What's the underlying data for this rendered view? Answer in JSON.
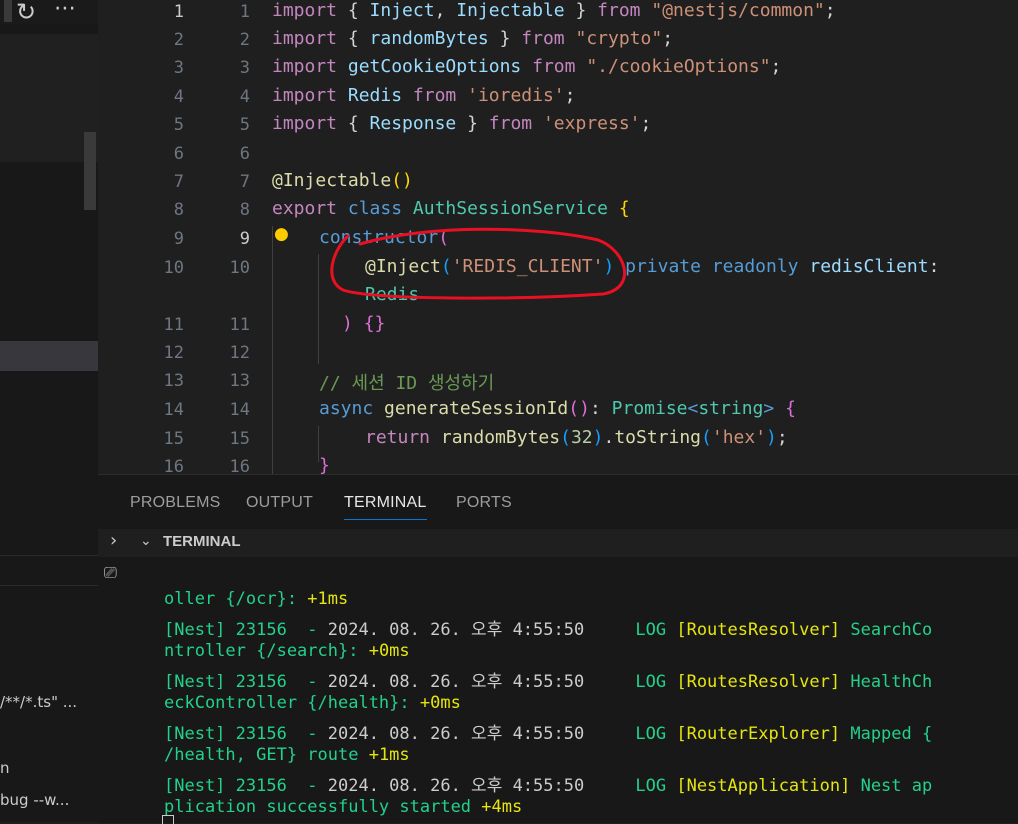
{
  "sidebar": {
    "toolbar_refresh_icon": "↻",
    "toolbar_more_icon": "⋯",
    "snippet_1": "/**/*.ts\" ...",
    "snippet_2": "n",
    "snippet_3": "bug --w..."
  },
  "editor": {
    "lines": [
      {
        "n1": "1",
        "n2": "1"
      },
      {
        "n1": "2",
        "n2": "2"
      },
      {
        "n1": "3",
        "n2": "3"
      },
      {
        "n1": "4",
        "n2": "4"
      },
      {
        "n1": "5",
        "n2": "5"
      },
      {
        "n1": "6",
        "n2": "6"
      },
      {
        "n1": "7",
        "n2": "7"
      },
      {
        "n1": "8",
        "n2": "8"
      },
      {
        "n1": "9",
        "n2": "9"
      },
      {
        "n1": "10",
        "n2": "10"
      },
      {
        "n1": "11",
        "n2": "11"
      },
      {
        "n1": "12",
        "n2": "12"
      },
      {
        "n1": "13",
        "n2": "13"
      },
      {
        "n1": "14",
        "n2": "14"
      },
      {
        "n1": "15",
        "n2": "15"
      },
      {
        "n1": "16",
        "n2": "16"
      }
    ],
    "code": {
      "l1": {
        "kw": "import",
        "a": " { ",
        "b": "Inject",
        "c": ", ",
        "d": "Injectable",
        "e": " } ",
        "f": "from",
        "g": " ",
        "h": "\"@nestjs/common\"",
        "i": ";"
      },
      "l2": {
        "kw": "import",
        "a": " { ",
        "b": "randomBytes",
        "c": " } ",
        "f": "from",
        "g": " ",
        "h": "\"crypto\"",
        "i": ";"
      },
      "l3": {
        "kw": "import",
        "a": " ",
        "b": "getCookieOptions",
        "c": " ",
        "f": "from",
        "g": " ",
        "h": "\"./cookieOptions\"",
        "i": ";"
      },
      "l4": {
        "kw": "import",
        "a": " ",
        "b": "Redis",
        "c": " ",
        "f": "from",
        "g": " ",
        "h": "'ioredis'",
        "i": ";"
      },
      "l5": {
        "kw": "import",
        "a": " { ",
        "b": "Response",
        "c": " } ",
        "f": "from",
        "g": " ",
        "h": "'express'",
        "i": ";"
      },
      "l7": {
        "at": "@",
        "fn": "Injectable",
        "p": "()"
      },
      "l8": {
        "kw": "export",
        "a": " ",
        "k2": "class",
        "b": " ",
        "cls": "AuthSessionService",
        "c": " ",
        "br": "{"
      },
      "l9": {
        "fn": "constructor",
        "br": "("
      },
      "l10": {
        "at": "@",
        "fn": "Inject",
        "p1": "(",
        "str": "'REDIS_CLIENT'",
        "p2": ")",
        "a": " ",
        "k1": "private",
        "b": " ",
        "k2": "readonly",
        "c": " ",
        "id": "redisClient",
        "d": ":"
      },
      "l10b": {
        "cls": "Redis"
      },
      "l11": {
        "br1": ")",
        "a": " ",
        "br2": "{}"
      },
      "l13": {
        "cm": "// 세션 ID 생성하기"
      },
      "l14": {
        "k": "async",
        "a": " ",
        "fn": "generateSessionId",
        "p": "()",
        "c": ": ",
        "cls": "Promise",
        "lt": "<",
        "t": "string",
        "gt": ">",
        "d": " ",
        "br": "{"
      },
      "l15": {
        "kw": "return",
        "a": " ",
        "fn": "randomBytes",
        "p1": "(",
        "num": "32",
        "p2": ")",
        "dot": ".",
        "fn2": "toString",
        "p3": "(",
        "str": "'hex'",
        "p4": ")",
        "semi": ";"
      },
      "l16": {
        "br": "}"
      }
    },
    "lightbulb_icon": "💡"
  },
  "panel": {
    "tabs": [
      "PROBLEMS",
      "OUTPUT",
      "TERMINAL",
      "PORTS"
    ],
    "active_tab": "TERMINAL",
    "terminal_header": "TERMINAL",
    "terminal_lines": [
      [
        {
          "t": "oller {/ocr}: ",
          "c": "tg"
        },
        {
          "t": "+1ms",
          "c": "ty"
        }
      ],
      [
        {
          "t": "[Nest] 23156  - ",
          "c": "tg"
        },
        {
          "t": "2024. 08. 26. 오후 4:55:50     ",
          "c": "tw"
        },
        {
          "t": "LOG ",
          "c": "tg"
        },
        {
          "t": "[RoutesResolver] ",
          "c": "ty"
        },
        {
          "t": "SearchCo",
          "c": "tg"
        }
      ],
      [
        {
          "t": "ntroller {/search}: ",
          "c": "tg"
        },
        {
          "t": "+0ms",
          "c": "ty"
        }
      ],
      [
        {
          "t": "[Nest] 23156  - ",
          "c": "tg"
        },
        {
          "t": "2024. 08. 26. 오후 4:55:50     ",
          "c": "tw"
        },
        {
          "t": "LOG ",
          "c": "tg"
        },
        {
          "t": "[RoutesResolver] ",
          "c": "ty"
        },
        {
          "t": "HealthCh",
          "c": "tg"
        }
      ],
      [
        {
          "t": "eckController {/health}: ",
          "c": "tg"
        },
        {
          "t": "+0ms",
          "c": "ty"
        }
      ],
      [
        {
          "t": "[Nest] 23156  - ",
          "c": "tg"
        },
        {
          "t": "2024. 08. 26. 오후 4:55:50     ",
          "c": "tw"
        },
        {
          "t": "LOG ",
          "c": "tg"
        },
        {
          "t": "[RouterExplorer] ",
          "c": "ty"
        },
        {
          "t": "Mapped {",
          "c": "tg"
        }
      ],
      [
        {
          "t": "/health, GET} route ",
          "c": "tg"
        },
        {
          "t": "+1ms",
          "c": "ty"
        }
      ],
      [
        {
          "t": "[Nest] 23156  - ",
          "c": "tg"
        },
        {
          "t": "2024. 08. 26. 오후 4:55:50     ",
          "c": "tw"
        },
        {
          "t": "LOG ",
          "c": "tg"
        },
        {
          "t": "[NestApplication] ",
          "c": "ty"
        },
        {
          "t": "Nest ap",
          "c": "tg"
        }
      ],
      [
        {
          "t": "plication successfully started ",
          "c": "tg"
        },
        {
          "t": "+4ms",
          "c": "ty"
        }
      ]
    ]
  },
  "colors": {
    "annotation_circle": "#e81123",
    "accent": "#0078d4"
  }
}
